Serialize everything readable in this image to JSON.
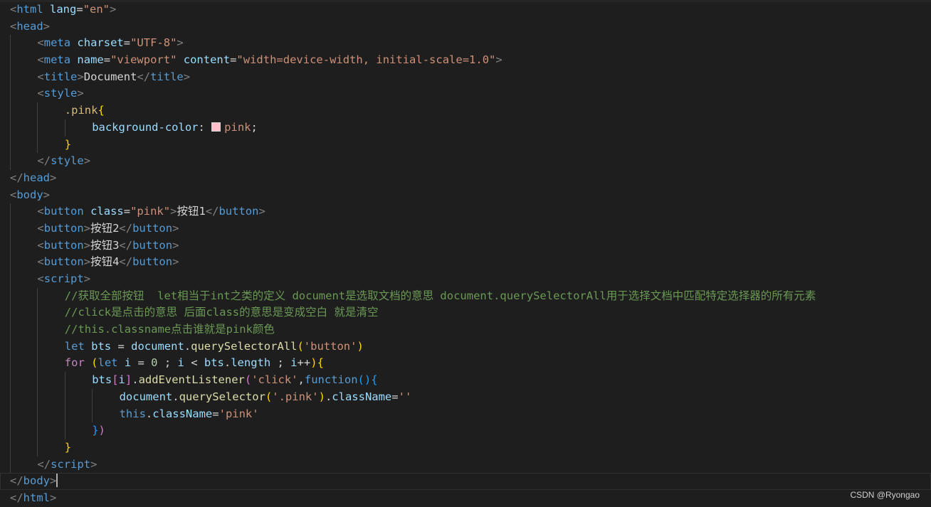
{
  "editor": {
    "watermark": "CSDN @Ryongao",
    "swatch_color": "#ffc0cb",
    "lines": {
      "l1": {
        "open": "<",
        "tag": "html",
        "attr": "lang",
        "eq": "=",
        "val": "\"en\"",
        "close": ">"
      },
      "l2": {
        "open": "<",
        "tag": "head",
        "close": ">"
      },
      "l3": {
        "open": "<",
        "tag": "meta",
        "attr": "charset",
        "eq": "=",
        "val": "\"UTF-8\"",
        "close": ">"
      },
      "l4": {
        "open": "<",
        "tag": "meta",
        "attr1": "name",
        "eq1": "=",
        "val1": "\"viewport\"",
        "attr2": "content",
        "eq2": "=",
        "val2": "\"width=device-width, initial-scale=1.0\"",
        "close": ">"
      },
      "l5": {
        "open": "<",
        "tag": "title",
        "close": ">",
        "text": "Document",
        "open2": "</",
        "tag2": "title",
        "close2": ">"
      },
      "l6": {
        "open": "<",
        "tag": "style",
        "close": ">"
      },
      "l7": {
        "selector": ".pink",
        "brace": "{"
      },
      "l8": {
        "prop": "background-color",
        "colon": ": ",
        "value": "pink",
        "semi": ";"
      },
      "l9": {
        "brace": "}"
      },
      "l10": {
        "open": "</",
        "tag": "style",
        "close": ">"
      },
      "l11": {
        "open": "</",
        "tag": "head",
        "close": ">"
      },
      "l12": {
        "open": "<",
        "tag": "body",
        "close": ">"
      },
      "l13": {
        "open": "<",
        "tag": "button",
        "attr": "class",
        "eq": "=",
        "val": "\"pink\"",
        "close": ">",
        "text": "按钮1",
        "open2": "</",
        "tag2": "button",
        "close2": ">"
      },
      "l14": {
        "open": "<",
        "tag": "button",
        "close": ">",
        "text": "按钮2",
        "open2": "</",
        "tag2": "button",
        "close2": ">"
      },
      "l15": {
        "open": "<",
        "tag": "button",
        "close": ">",
        "text": "按钮3",
        "open2": "</",
        "tag2": "button",
        "close2": ">"
      },
      "l16": {
        "open": "<",
        "tag": "button",
        "close": ">",
        "text": "按钮4",
        "open2": "</",
        "tag2": "button",
        "close2": ">"
      },
      "l17": {
        "open": "<",
        "tag": "script",
        "close": ">"
      },
      "l18": {
        "comment": "//获取全部按钮  let相当于int之类的定义 document是选取文档的意思 document.querySelectorAll用于选择文档中匹配特定选择器的所有元素"
      },
      "l19": {
        "comment": "//click是点击的意思 后面class的意思是变成空白 就是清空"
      },
      "l20": {
        "comment": "//this.classname点击谁就是pink颜色"
      },
      "l21": {
        "kw": "let",
        "var": "bts",
        "eq": " = ",
        "obj": "document",
        "dot": ".",
        "fn": "querySelectorAll",
        "p1": "(",
        "str": "'button'",
        "p2": ")"
      },
      "l22": {
        "kw": "for",
        "p1": "(",
        "kw2": "let",
        "var": "i",
        "eq": " = ",
        "num": "0",
        "semi": " ; ",
        "var2": "i",
        "lt": " < ",
        "var3": "bts",
        "dot": ".",
        "prop": "length",
        "semi2": " ; ",
        "var4": "i",
        "inc": "++",
        "p2": ")",
        "brace": "{"
      },
      "l23": {
        "var": "bts",
        "b1": "[",
        "idx": "i",
        "b2": "]",
        "dot": ".",
        "fn": "addEventListener",
        "p1": "(",
        "str": "'click'",
        "comma": ",",
        "kw": "function",
        "p2": "()",
        "brace": "{"
      },
      "l24": {
        "obj": "document",
        "dot": ".",
        "fn": "querySelector",
        "p1": "(",
        "str": "'.pink'",
        "p2": ")",
        "dot2": ".",
        "prop": "className",
        "eq": "=",
        "str2": "''"
      },
      "l25": {
        "kw": "this",
        "dot": ".",
        "prop": "className",
        "eq": "=",
        "str": "'pink'"
      },
      "l26": {
        "brace": "}",
        "paren": ")"
      },
      "l27": {
        "brace": "}"
      },
      "l28": {
        "open": "</",
        "tag": "script",
        "close": ">"
      },
      "l29": {
        "open": "</",
        "tag": "body",
        "close": ">"
      },
      "l30": {
        "open": "</",
        "tag": "html",
        "close": ">"
      }
    }
  }
}
